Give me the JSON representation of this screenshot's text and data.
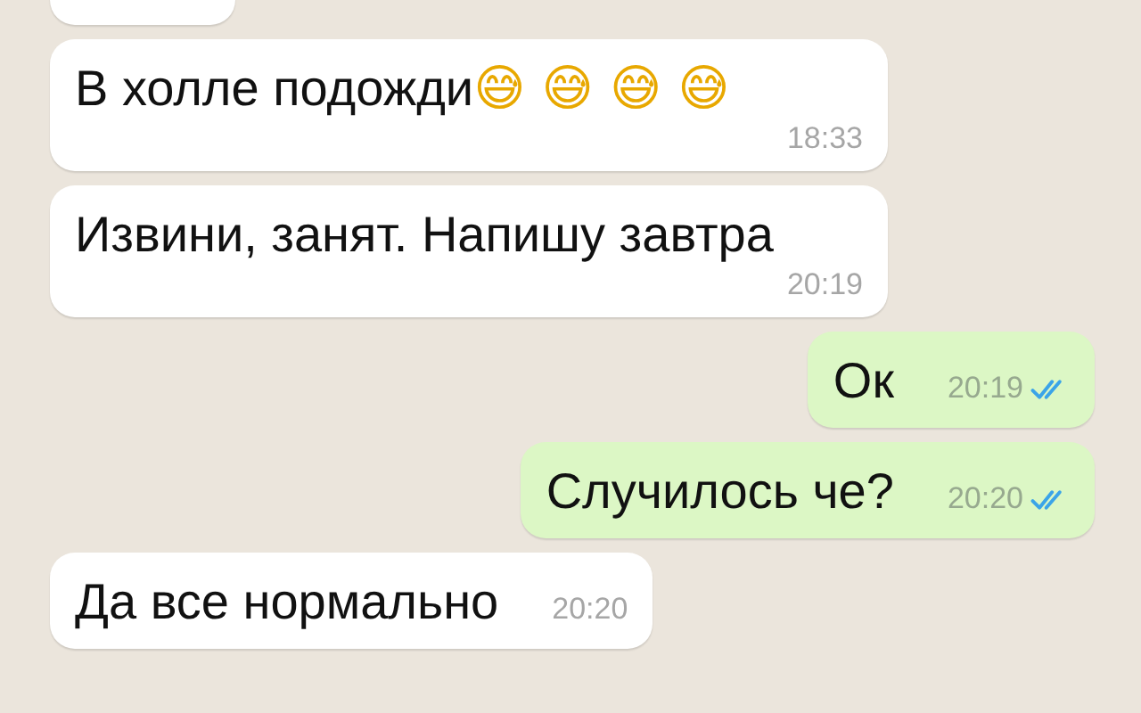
{
  "messages": [
    {
      "kind": "in"
    },
    {
      "kind": "in",
      "text": "В холле подожди",
      "emoji": "😅😅😅😅",
      "time": "18:33"
    },
    {
      "kind": "in",
      "text": "Извини, занят. Напишу завтра",
      "time": "20:19"
    },
    {
      "kind": "out",
      "text": "Ок",
      "time": "20:19",
      "read": true
    },
    {
      "kind": "out",
      "text": "Случилось че?",
      "time": "20:20",
      "read": true
    },
    {
      "kind": "in",
      "text": "Да все нормально",
      "time": "20:20"
    }
  ]
}
